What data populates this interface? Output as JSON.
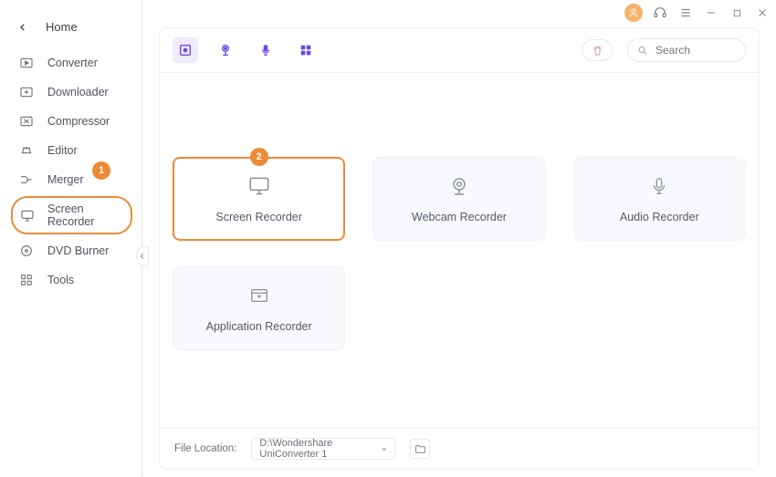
{
  "window": {
    "avatar_icon": "user-icon"
  },
  "sidebar": {
    "back": "‹",
    "title": "Home",
    "items": [
      {
        "label": "Converter"
      },
      {
        "label": "Downloader"
      },
      {
        "label": "Compressor"
      },
      {
        "label": "Editor"
      },
      {
        "label": "Merger"
      },
      {
        "label": "Screen Recorder"
      },
      {
        "label": "DVD Burner"
      },
      {
        "label": "Tools"
      }
    ]
  },
  "callouts": {
    "sidebar": "1",
    "card": "2"
  },
  "search": {
    "placeholder": "Search"
  },
  "cards": {
    "screen": "Screen Recorder",
    "webcam": "Webcam Recorder",
    "audio": "Audio Recorder",
    "app": "Application Recorder"
  },
  "footer": {
    "label": "File Location:",
    "path": "D:\\Wondershare UniConverter 1"
  }
}
